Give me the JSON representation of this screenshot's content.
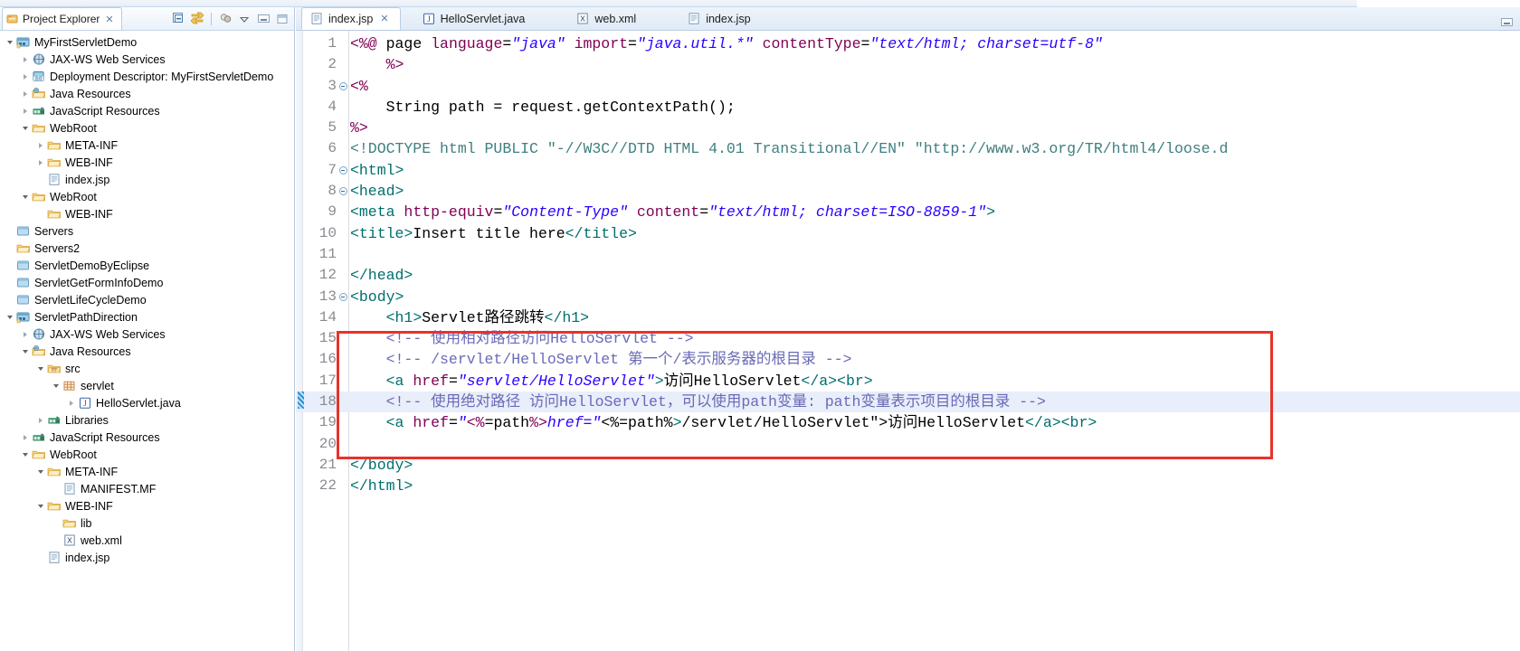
{
  "window": {
    "minimize_label": "▬"
  },
  "explorer": {
    "title": "Project Explorer",
    "close_glyph": "✕",
    "toolbar": [
      {
        "name": "collapse-all-icon",
        "title": "Collapse All"
      },
      {
        "name": "link-with-editor-icon",
        "title": "Link with Editor"
      },
      {
        "name": "focus-on-active-task-icon",
        "title": "Focus on Active Task"
      },
      {
        "name": "view-menu-icon",
        "title": "View Menu"
      },
      {
        "name": "minimize-icon",
        "title": "Minimize"
      },
      {
        "name": "maximize-icon",
        "title": "Maximize"
      }
    ],
    "tree": [
      {
        "label": "MyFirstServletDemo",
        "depth": 0,
        "arrow": "down",
        "icon": "project",
        "decorated": true
      },
      {
        "label": "JAX-WS Web Services",
        "depth": 1,
        "arrow": "right",
        "icon": "jaxws"
      },
      {
        "label": "Deployment Descriptor: MyFirstServletDemo",
        "depth": 1,
        "arrow": "right",
        "icon": "deployment"
      },
      {
        "label": "Java Resources",
        "depth": 1,
        "arrow": "right",
        "icon": "javares"
      },
      {
        "label": "JavaScript Resources",
        "depth": 1,
        "arrow": "right",
        "icon": "jsres"
      },
      {
        "label": "WebRoot",
        "depth": 1,
        "arrow": "down",
        "icon": "folder"
      },
      {
        "label": "META-INF",
        "depth": 2,
        "arrow": "right",
        "icon": "folder"
      },
      {
        "label": "WEB-INF",
        "depth": 2,
        "arrow": "right",
        "icon": "folder"
      },
      {
        "label": "index.jsp",
        "depth": 2,
        "arrow": "none",
        "icon": "jsp"
      },
      {
        "label": "WebRoot",
        "depth": 1,
        "arrow": "down",
        "icon": "folder"
      },
      {
        "label": "WEB-INF",
        "depth": 2,
        "arrow": "none",
        "icon": "folder"
      },
      {
        "label": "Servers",
        "depth": 0,
        "arrow": "none",
        "icon": "closedproject"
      },
      {
        "label": "Servers2",
        "depth": 0,
        "arrow": "none",
        "icon": "folder"
      },
      {
        "label": "ServletDemoByEclipse",
        "depth": 0,
        "arrow": "none",
        "icon": "closedproject"
      },
      {
        "label": "ServletGetFormInfoDemo",
        "depth": 0,
        "arrow": "none",
        "icon": "closedproject"
      },
      {
        "label": "ServletLifeCycleDemo",
        "depth": 0,
        "arrow": "none",
        "icon": "closedproject"
      },
      {
        "label": "ServletPathDirection",
        "depth": 0,
        "arrow": "down",
        "icon": "project",
        "decorated": true
      },
      {
        "label": "JAX-WS Web Services",
        "depth": 1,
        "arrow": "right",
        "icon": "jaxws"
      },
      {
        "label": "Java Resources",
        "depth": 1,
        "arrow": "down",
        "icon": "javares"
      },
      {
        "label": "src",
        "depth": 2,
        "arrow": "down",
        "icon": "srcfolder"
      },
      {
        "label": "servlet",
        "depth": 3,
        "arrow": "down",
        "icon": "package"
      },
      {
        "label": "HelloServlet.java",
        "depth": 4,
        "arrow": "right",
        "icon": "java"
      },
      {
        "label": "Libraries",
        "depth": 2,
        "arrow": "right",
        "icon": "library"
      },
      {
        "label": "JavaScript Resources",
        "depth": 1,
        "arrow": "right",
        "icon": "jsres"
      },
      {
        "label": "WebRoot",
        "depth": 1,
        "arrow": "down",
        "icon": "folder"
      },
      {
        "label": "META-INF",
        "depth": 2,
        "arrow": "down",
        "icon": "folder"
      },
      {
        "label": "MANIFEST.MF",
        "depth": 3,
        "arrow": "none",
        "icon": "file"
      },
      {
        "label": "WEB-INF",
        "depth": 2,
        "arrow": "down",
        "icon": "folder"
      },
      {
        "label": "lib",
        "depth": 3,
        "arrow": "none",
        "icon": "folder"
      },
      {
        "label": "web.xml",
        "depth": 3,
        "arrow": "none",
        "icon": "xml"
      },
      {
        "label": "index.jsp",
        "depth": 2,
        "arrow": "none",
        "icon": "jsp"
      }
    ]
  },
  "editor": {
    "tabs": [
      {
        "label": "index.jsp",
        "icon": "jsp",
        "active": true,
        "closeable": true
      },
      {
        "label": "HelloServlet.java",
        "icon": "java",
        "active": false,
        "closeable": false
      },
      {
        "label": "web.xml",
        "icon": "xml",
        "active": false,
        "closeable": false
      },
      {
        "label": "index.jsp",
        "icon": "jsp",
        "active": false,
        "closeable": false
      }
    ],
    "highlighted_line": 18,
    "annotation_box": {
      "color": "#e8322a",
      "from_line": 15,
      "to_line": 20
    },
    "lines": [
      {
        "n": 1,
        "fold": "",
        "text": "<%@ page language=\"java\" import=\"java.util.*\" contentType=\"text/html; charset=utf-8\""
      },
      {
        "n": 2,
        "fold": "",
        "text": "    %>"
      },
      {
        "n": 3,
        "fold": "-",
        "text": "<%"
      },
      {
        "n": 4,
        "fold": "",
        "text": "    String path = request.getContextPath();"
      },
      {
        "n": 5,
        "fold": "",
        "text": "%>"
      },
      {
        "n": 6,
        "fold": "",
        "text": "<!DOCTYPE html PUBLIC \"-//W3C//DTD HTML 4.01 Transitional//EN\" \"http://www.w3.org/TR/html4/loose.d"
      },
      {
        "n": 7,
        "fold": "-",
        "text": "<html>"
      },
      {
        "n": 8,
        "fold": "-",
        "text": "<head>"
      },
      {
        "n": 9,
        "fold": "",
        "text": "<meta http-equiv=\"Content-Type\" content=\"text/html; charset=ISO-8859-1\">"
      },
      {
        "n": 10,
        "fold": "",
        "text": "<title>Insert title here</title>"
      },
      {
        "n": 11,
        "fold": "",
        "text": ""
      },
      {
        "n": 12,
        "fold": "",
        "text": "</head>"
      },
      {
        "n": 13,
        "fold": "-",
        "text": "<body>"
      },
      {
        "n": 14,
        "fold": "",
        "text": "    <h1>Servlet路径跳转</h1>"
      },
      {
        "n": 15,
        "fold": "",
        "text": "    <!-- 使用相对路径访问HelloServlet -->"
      },
      {
        "n": 16,
        "fold": "",
        "text": "    <!-- /servlet/HelloServlet 第一个/表示服务器的根目录 -->"
      },
      {
        "n": 17,
        "fold": "",
        "text": "    <a href=\"servlet/HelloServlet\">访问HelloServlet</a><br>"
      },
      {
        "n": 18,
        "fold": "",
        "text": "    <!-- 使用绝对路径 访问HelloServlet，可以使用path变量: path变量表示项目的根目录 -->"
      },
      {
        "n": 19,
        "fold": "",
        "text": "    <a href=\"<%=path%>/servlet/HelloServlet\">访问HelloServlet</a><br>"
      },
      {
        "n": 20,
        "fold": "",
        "text": ""
      },
      {
        "n": 21,
        "fold": "",
        "text": "</body>"
      },
      {
        "n": 22,
        "fold": "",
        "text": "</html>"
      }
    ]
  },
  "colors": {
    "accent_red": "#e8322a",
    "selection_blue": "#e8eefa",
    "string": "#2a00ff",
    "attribute": "#7f0055",
    "tag": "#006e6e",
    "comment": "#6a6ab7",
    "gutter_text": "#888b8f"
  }
}
